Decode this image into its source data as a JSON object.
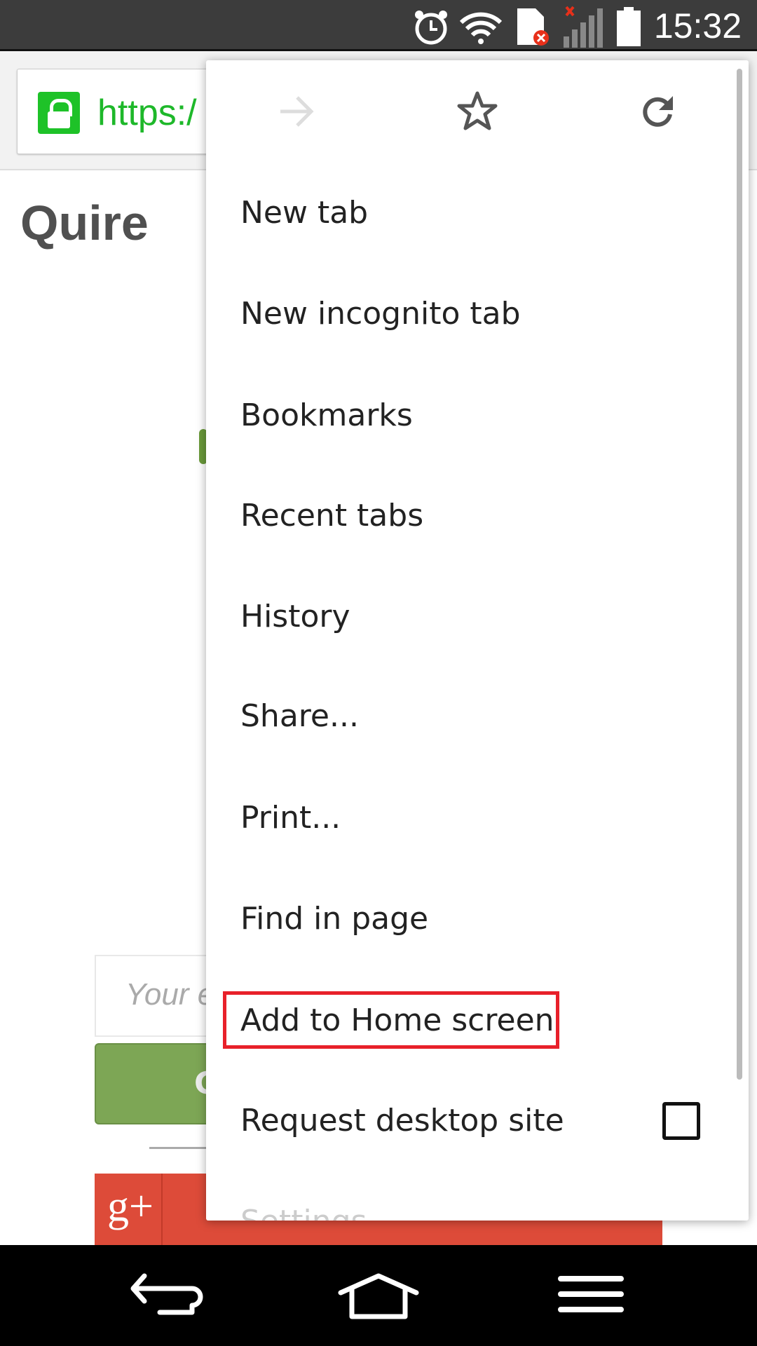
{
  "status_bar": {
    "time": "15:32",
    "icons": [
      "alarm-icon",
      "wifi-icon",
      "sim-error-icon",
      "signal-icon",
      "battery-icon"
    ]
  },
  "toolbar": {
    "url_scheme": "https:/",
    "lock_color": "#1ec228"
  },
  "page": {
    "title": "Quire",
    "email_placeholder": "Your e",
    "go_button_label": "G",
    "gplus_icon": "g+",
    "gplus_label": ""
  },
  "menu": {
    "icons": [
      "forward-icon",
      "bookmark-star-icon",
      "reload-icon"
    ],
    "items": [
      {
        "label": "New tab"
      },
      {
        "label": "New incognito tab"
      },
      {
        "label": "Bookmarks"
      },
      {
        "label": "Recent tabs"
      },
      {
        "label": "History"
      },
      {
        "label": "Share..."
      },
      {
        "label": "Print..."
      },
      {
        "label": "Find in page"
      },
      {
        "label": "Add to Home screen",
        "highlighted": true
      },
      {
        "label": "Request desktop site",
        "checkbox": false
      },
      {
        "label": "Settings"
      }
    ],
    "highlight_color": "#e8202a"
  },
  "nav_bar": {
    "buttons": [
      "back-button",
      "home-button",
      "menu-button"
    ]
  }
}
